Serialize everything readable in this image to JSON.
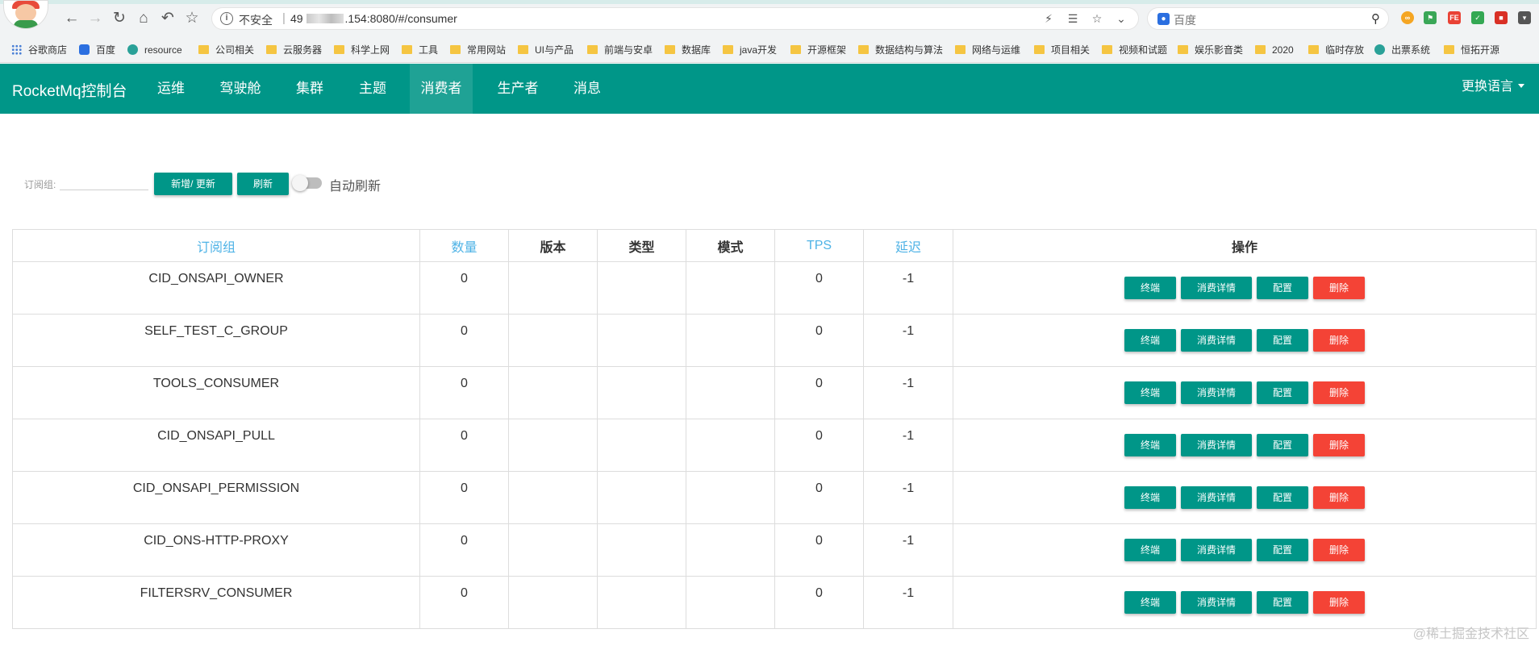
{
  "browser": {
    "security_text": "不安全",
    "url_prefix": "49",
    "url_suffix": ".154:8080/#/consumer",
    "search_engine": "百度",
    "bookmarks": [
      {
        "icon": "apps-icon",
        "label": "谷歌商店"
      },
      {
        "icon": "baidu-icon",
        "label": "百度"
      },
      {
        "icon": "globe-icon",
        "label": "resource"
      },
      {
        "icon": "folder-icon",
        "label": "公司相关"
      },
      {
        "icon": "folder-icon",
        "label": "云服务器"
      },
      {
        "icon": "folder-icon",
        "label": "科学上网"
      },
      {
        "icon": "folder-icon",
        "label": "工具"
      },
      {
        "icon": "folder-icon",
        "label": "常用网站"
      },
      {
        "icon": "folder-icon",
        "label": "UI与产品"
      },
      {
        "icon": "folder-icon",
        "label": "前端与安卓"
      },
      {
        "icon": "folder-icon",
        "label": "数据库"
      },
      {
        "icon": "folder-icon",
        "label": "java开发"
      },
      {
        "icon": "folder-icon",
        "label": "开源框架"
      },
      {
        "icon": "folder-icon",
        "label": "数据结构与算法"
      },
      {
        "icon": "folder-icon",
        "label": "网络与运维"
      },
      {
        "icon": "folder-icon",
        "label": "项目相关"
      },
      {
        "icon": "folder-icon",
        "label": "视频和试题"
      },
      {
        "icon": "folder-icon",
        "label": "娱乐影音类"
      },
      {
        "icon": "folder-icon",
        "label": "2020"
      },
      {
        "icon": "folder-icon",
        "label": "临时存放"
      },
      {
        "icon": "globe-icon",
        "label": "出票系统"
      },
      {
        "icon": "folder-icon",
        "label": "恒拓开源"
      }
    ]
  },
  "navbar": {
    "brand": "RocketMq控制台",
    "items": [
      "运维",
      "驾驶舱",
      "集群",
      "主题",
      "消费者",
      "生产者",
      "消息"
    ],
    "active_index": 4,
    "language": "更换语言",
    "color": "#009688"
  },
  "toolbar": {
    "group_label": "订阅组:",
    "group_value": "",
    "add_update_label": "新增/ 更新",
    "refresh_label": "刷新",
    "auto_refresh_label": "自动刷新",
    "auto_refresh_on": false
  },
  "table": {
    "headers": [
      "订阅组",
      "数量",
      "版本",
      "类型",
      "模式",
      "TPS",
      "延迟",
      "操作"
    ],
    "sortable_color": "#4fb3e6",
    "actions": {
      "terminal": "终端",
      "consume_detail": "消费详情",
      "config": "配置",
      "delete": "删除"
    },
    "rows": [
      {
        "group": "CID_ONSAPI_OWNER",
        "count": "0",
        "version": "",
        "type": "",
        "mode": "",
        "tps": "0",
        "delay": "-1"
      },
      {
        "group": "SELF_TEST_C_GROUP",
        "count": "0",
        "version": "",
        "type": "",
        "mode": "",
        "tps": "0",
        "delay": "-1"
      },
      {
        "group": "TOOLS_CONSUMER",
        "count": "0",
        "version": "",
        "type": "",
        "mode": "",
        "tps": "0",
        "delay": "-1"
      },
      {
        "group": "CID_ONSAPI_PULL",
        "count": "0",
        "version": "",
        "type": "",
        "mode": "",
        "tps": "0",
        "delay": "-1"
      },
      {
        "group": "CID_ONSAPI_PERMISSION",
        "count": "0",
        "version": "",
        "type": "",
        "mode": "",
        "tps": "0",
        "delay": "-1"
      },
      {
        "group": "CID_ONS-HTTP-PROXY",
        "count": "0",
        "version": "",
        "type": "",
        "mode": "",
        "tps": "0",
        "delay": "-1"
      },
      {
        "group": "FILTERSRV_CONSUMER",
        "count": "0",
        "version": "",
        "type": "",
        "mode": "",
        "tps": "0",
        "delay": "-1"
      }
    ]
  },
  "watermark": "@稀土掘金技术社区"
}
